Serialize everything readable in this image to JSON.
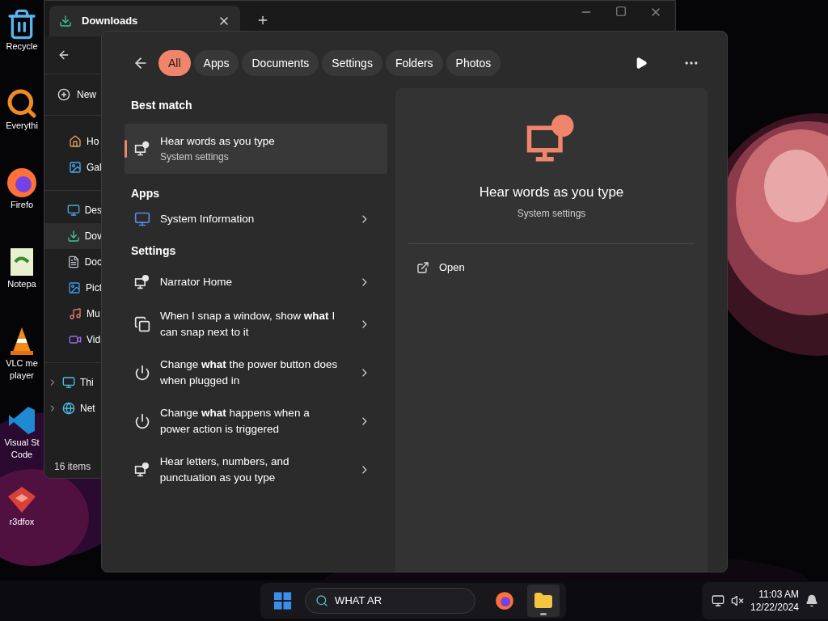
{
  "desktop_icons": [
    {
      "kind": "recycle",
      "lines": [
        "Recycle"
      ]
    },
    {
      "kind": "everything",
      "lines": [
        "Everythi"
      ]
    },
    {
      "kind": "firefox",
      "lines": [
        "Firefo"
      ]
    },
    {
      "kind": "notepad",
      "lines": [
        "Notepa"
      ]
    },
    {
      "kind": "vlc",
      "lines": [
        "VLC me",
        "player"
      ]
    },
    {
      "kind": "vscode",
      "lines": [
        "Visual St",
        "Code"
      ]
    },
    {
      "kind": "r3dfox",
      "lines": [
        "r3dfox"
      ]
    }
  ],
  "explorer": {
    "tab_title": "Downloads",
    "new_label": "New",
    "nav_groups": [
      [
        {
          "kind": "home",
          "label": "Ho",
          "selected": false
        },
        {
          "kind": "gallery",
          "label": "Gal",
          "selected": false
        }
      ],
      [
        {
          "kind": "desktop",
          "label": "Des",
          "selected": false
        },
        {
          "kind": "downloads",
          "label": "Dov",
          "selected": true
        },
        {
          "kind": "documents",
          "label": "Doc",
          "selected": false
        },
        {
          "kind": "pictures",
          "label": "Pict",
          "selected": false
        },
        {
          "kind": "music",
          "label": "Mu",
          "selected": false
        },
        {
          "kind": "videos",
          "label": "Vid",
          "selected": false
        }
      ],
      [
        {
          "kind": "pc",
          "label": "Thi",
          "selected": false,
          "expanded": false
        },
        {
          "kind": "network",
          "label": "Net",
          "selected": false,
          "expanded": false
        }
      ]
    ],
    "status": "16 items"
  },
  "search": {
    "filters": [
      {
        "label": "All",
        "selected": true
      },
      {
        "label": "Apps",
        "selected": false
      },
      {
        "label": "Documents",
        "selected": false
      },
      {
        "label": "Settings",
        "selected": false
      },
      {
        "label": "Folders",
        "selected": false
      },
      {
        "label": "Photos",
        "selected": false
      }
    ],
    "sections": [
      {
        "title": "Best match",
        "items": [
          {
            "kind": "narrator",
            "title": "Hear words as you type",
            "subtitle": "System settings",
            "selected": true
          }
        ]
      },
      {
        "title": "Apps",
        "items": [
          {
            "kind": "sysinfo",
            "title": "System Information",
            "selected": false
          }
        ]
      },
      {
        "title": "Settings",
        "items": [
          {
            "kind": "narrator",
            "title": "Narrator Home",
            "selected": false
          },
          {
            "kind": "snap",
            "title": "When I snap a window, show **what** I can snap next to it",
            "selected": false
          },
          {
            "kind": "power",
            "title": "Change **what** the power button does when plugged in",
            "selected": false
          },
          {
            "kind": "power",
            "title": "Change **what** happens when a power action is triggered",
            "selected": false
          },
          {
            "kind": "narrator",
            "title": "Hear letters, numbers, and punctuation as you type",
            "selected": false
          }
        ]
      }
    ],
    "preview": {
      "title": "Hear words as you type",
      "subtitle": "System settings",
      "actions": [
        "Open"
      ]
    }
  },
  "taskbar": {
    "search_value": "WHAT AR",
    "apps": [
      {
        "kind": "firefox",
        "selected": false
      },
      {
        "kind": "explorer",
        "selected": true
      }
    ],
    "time": "11:03 AM",
    "date": "12/22/2024"
  }
}
